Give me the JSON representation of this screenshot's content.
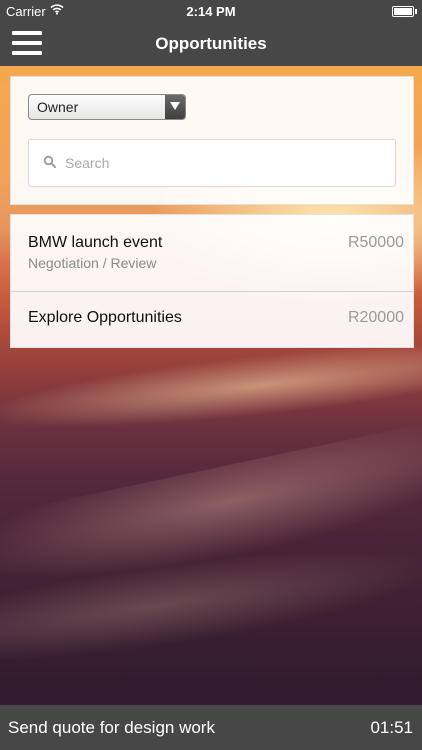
{
  "status_bar": {
    "carrier": "Carrier",
    "time": "2:14 PM",
    "wifi_icon": "wifi-icon",
    "battery_icon": "battery-icon"
  },
  "nav": {
    "title": "Opportunities",
    "menu_icon": "hamburger-menu-icon"
  },
  "filter": {
    "owner_select": "Owner",
    "search_placeholder": "Search",
    "search_value": ""
  },
  "opportunities": [
    {
      "name": "BMW launch event",
      "stage": "Negotiation / Review",
      "amount": "R50000"
    },
    {
      "name": "Explore Opportunities",
      "stage": "",
      "amount": "R20000"
    }
  ],
  "bottom_bar": {
    "task": "Send quote for design work",
    "timer": "01:51"
  },
  "colors": {
    "bar_background": "#474747",
    "panel_background": "#ffffff"
  }
}
